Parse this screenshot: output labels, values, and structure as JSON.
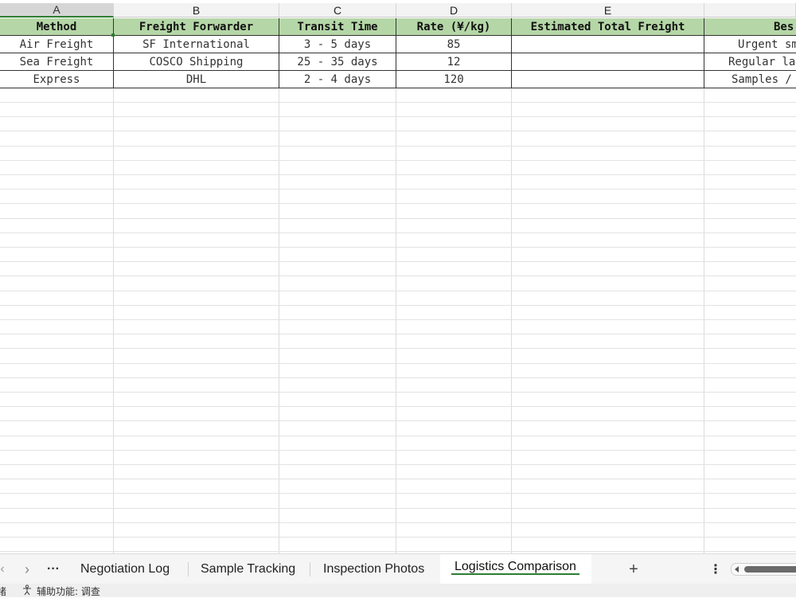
{
  "columns": [
    "A",
    "B",
    "C",
    "D",
    "E"
  ],
  "header_row": [
    "Method",
    "Freight Forwarder",
    "Transit Time",
    "Rate (¥/kg)",
    "Estimated Total Freight",
    "Bes"
  ],
  "rows": [
    [
      "Air Freight",
      "SF International",
      "3 - 5 days",
      "85",
      "",
      "Urgent sma"
    ],
    [
      "Sea Freight",
      "COSCO Shipping",
      "25 - 35 days",
      "12",
      "",
      "Regular lar"
    ],
    [
      "Express",
      "DHL",
      "2 - 4 days",
      "120",
      "",
      "Samples / "
    ]
  ],
  "sheet_tabs": [
    "Negotiation Log",
    "Sample Tracking",
    "Inspection Photos",
    "Logistics Comparison"
  ],
  "active_tab": "Logistics Comparison",
  "tab_nav": {
    "next": "›",
    "more": "···",
    "add": "+",
    "menu": "⋮"
  },
  "status": {
    "ready": "绪",
    "accessibility": "辅助功能: 调查"
  },
  "colors": {
    "header_fill": "#b5d7a7",
    "active_accent": "#2e7d32"
  }
}
